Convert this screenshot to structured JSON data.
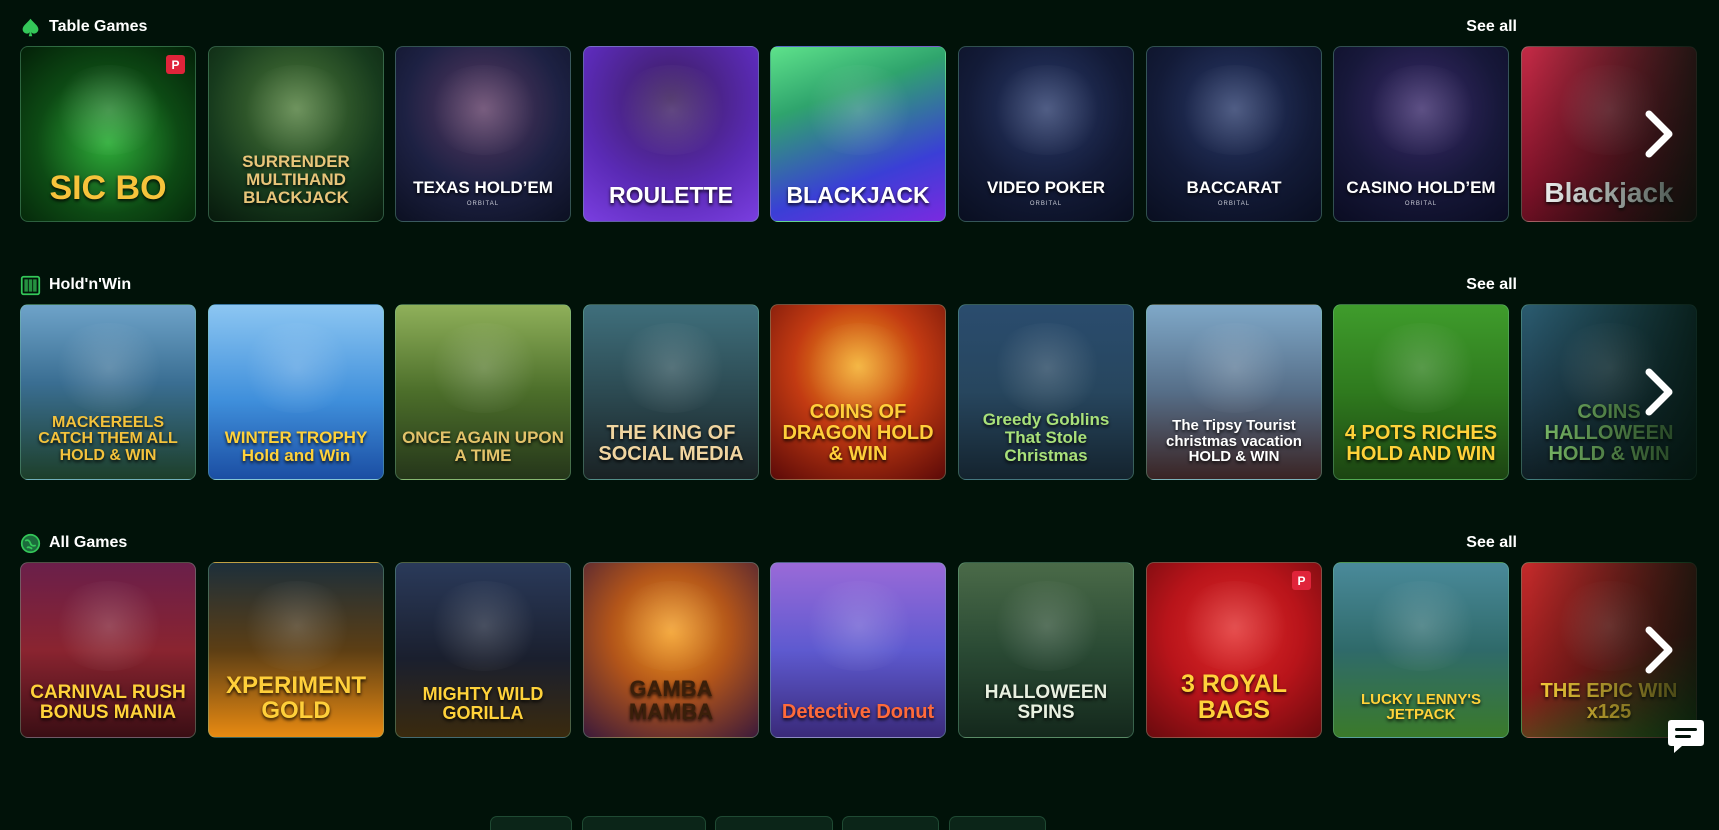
{
  "sections": [
    {
      "title": "Table Games",
      "icon": "spade-icon",
      "see_all": "See all",
      "tiles": [
        {
          "title": "SIC BO",
          "sub": "",
          "badge": "P",
          "bg": "radial-gradient(circle at 50% 55%, #2fae3a 0%, #0d4a14 55%, #032008 100%)",
          "title_color": "#f6c33b",
          "size": 34
        },
        {
          "title": "SURRENDER MULTIHAND BLACKJACK",
          "sub": "",
          "badge": "",
          "bg": "radial-gradient(circle at 50% 35%, #4f7c3b 0%, #173b1d 60%, #07190c 100%)",
          "title_color": "#e8c57a",
          "size": 17
        },
        {
          "title": "TEXAS HOLD’EM",
          "sub": "ORBITAL",
          "badge": "",
          "bg": "radial-gradient(circle at 50% 35%, #5b3a63 0%, #1d2143 55%, #0c1022 100%)",
          "title_color": "#ffffff",
          "size": 17
        },
        {
          "title": "ROULETTE",
          "sub": "",
          "badge": "",
          "bg": "radial-gradient(circle at 50% 30%, #3a1d5a 0%, #5a2ab5 60%, #7a3ee0 100%)",
          "title_color": "#ffffff",
          "size": 23
        },
        {
          "title": "BLACKJACK",
          "sub": "",
          "badge": "",
          "bg": "linear-gradient(160deg, #5ee28b 0%, #2fa46d 30%, #3a3fd6 70%, #7a2ae0 100%)",
          "title_color": "#ffffff",
          "size": 23
        },
        {
          "title": "VIDEO POKER",
          "sub": "ORBITAL",
          "badge": "",
          "bg": "radial-gradient(circle at 50% 35%, #2a3a6a 0%, #131b38 55%, #090e20 100%)",
          "title_color": "#ffffff",
          "size": 17
        },
        {
          "title": "BACCARAT",
          "sub": "ORBITAL",
          "badge": "",
          "bg": "radial-gradient(circle at 50% 35%, #2a3a6a 0%, #131b38 55%, #090e20 100%)",
          "title_color": "#ffffff",
          "size": 17
        },
        {
          "title": "CASINO HOLD’EM",
          "sub": "ORBITAL",
          "badge": "",
          "bg": "radial-gradient(circle at 50% 35%, #3a2a6a 0%, #17183a 55%, #0a0c22 100%)",
          "title_color": "#ffffff",
          "size": 17
        },
        {
          "title": "Blackjack",
          "sub": "",
          "badge": "",
          "bg": "linear-gradient(160deg, #c22a45 0%, #7c1228 60%, #3c0812 100%)",
          "title_color": "#ffffff",
          "size": 28
        }
      ]
    },
    {
      "title": "Hold'n'Win",
      "icon": "slot-machine-icon",
      "see_all": "See all",
      "tiles": [
        {
          "title": "MACKEREELS CATCH THEM ALL HOLD & WIN",
          "sub": "",
          "badge": "",
          "bg": "linear-gradient(180deg, #6ea3c9 0%, #3a6e92 45%, #1d3f2a 100%)",
          "title_color": "#f3c23c",
          "size": 16
        },
        {
          "title": "WINTER TROPHY Hold and Win",
          "sub": "",
          "badge": "",
          "bg": "linear-gradient(180deg, #8cc6f2 0%, #3f8fdb 55%, #1b4ea3 100%)",
          "title_color": "#ffd23a",
          "size": 17
        },
        {
          "title": "ONCE AGAIN UPON A TIME",
          "sub": "",
          "badge": "",
          "bg": "linear-gradient(180deg, #8fb05a 0%, #4c6e2a 50%, #25361a 100%)",
          "title_color": "#e3c36a",
          "size": 17
        },
        {
          "title": "THE KING OF SOCIAL MEDIA",
          "sub": "",
          "badge": "",
          "bg": "linear-gradient(180deg, #3f6f7c 0%, #2c4a52 50%, #1a2224 100%)",
          "title_color": "#f0d5a0",
          "size": 20
        },
        {
          "title": "COINS OF DRAGON HOLD & WIN",
          "sub": "",
          "badge": "",
          "bg": "radial-gradient(circle at 50% 35%, #f2a81e 0%, #c23a12 45%, #5c0a08 100%)",
          "title_color": "#ffcf3a",
          "size": 20
        },
        {
          "title": "Greedy Goblins That Stole Christmas",
          "sub": "",
          "badge": "",
          "bg": "linear-gradient(180deg, #2a4c6e 0%, #27465e 50%, #14232e 100%)",
          "title_color": "#a8e07a",
          "size": 17
        },
        {
          "title": "The Tipsy Tourist christmas vacation HOLD & WIN",
          "sub": "",
          "badge": "",
          "bg": "linear-gradient(180deg, #7fa8c8 0%, #566e88 50%, #3a2424 100%)",
          "title_color": "#ffffff",
          "size": 15
        },
        {
          "title": "4 POTS RICHES HOLD AND WIN",
          "sub": "",
          "badge": "",
          "bg": "linear-gradient(180deg, #3f9c2c 0%, #2f7a1e 50%, #1c4412 100%)",
          "title_color": "#ffd23a",
          "size": 20
        },
        {
          "title": "COINS HALLOWEEN HOLD & WIN",
          "sub": "",
          "badge": "",
          "bg": "linear-gradient(180deg, #2a5a6e 0%, #1f3e4e 50%, #0f1e24 100%)",
          "title_color": "#7fc06a",
          "size": 20
        }
      ]
    },
    {
      "title": "All Games",
      "icon": "globe-icon",
      "see_all": "See all",
      "tiles": [
        {
          "title": "CARNIVAL RUSH BONUS MANIA",
          "sub": "",
          "badge": "",
          "bg": "linear-gradient(180deg, #6a1f4a 0%, #8a2430 50%, #3a0e14 100%)",
          "title_color": "#ffd23a",
          "size": 19
        },
        {
          "title": "XPERIMENT GOLD",
          "sub": "",
          "badge": "",
          "bg": "linear-gradient(180deg, #1d2f3a 0%, #5c3e14 50%, #e88a12 100%)",
          "title_color": "#ffcf3a",
          "size": 24
        },
        {
          "title": "MIGHTY WILD GORILLA",
          "sub": "",
          "badge": "",
          "bg": "linear-gradient(180deg, #2a3a5a 0%, #1a1f2e 55%, #3a2a0e 100%)",
          "title_color": "#ffd23a",
          "size": 18
        },
        {
          "title": "GAMBA MAMBA",
          "sub": "",
          "badge": "",
          "bg": "radial-gradient(circle at 50% 40%, #f29a1e 0%, #b1541a 45%, #3c1a3a 100%)",
          "title_color": "#3a1f0a",
          "size": 22
        },
        {
          "title": "Detective Donut",
          "sub": "",
          "badge": "",
          "bg": "linear-gradient(180deg, #9a6ad8 0%, #5e5ad0 50%, #3a2a7a 100%)",
          "title_color": "#ff6a3a",
          "size": 20
        },
        {
          "title": "HALLOWEEN SPINS",
          "sub": "",
          "badge": "",
          "bg": "linear-gradient(180deg, #4a6a48 0%, #2a4a34 50%, #14281c 100%)",
          "title_color": "#e8f0e0",
          "size": 19
        },
        {
          "title": "3 ROYAL BAGS",
          "sub": "",
          "badge": "P",
          "bg": "radial-gradient(circle at 50% 40%, #e02a2a 0%, #b8141a 50%, #6a0a0e 100%)",
          "title_color": "#ffd23a",
          "size": 25
        },
        {
          "title": "LUCKY LENNY'S JETPACK",
          "sub": "",
          "badge": "",
          "bg": "linear-gradient(180deg, #4a8a9a 0%, #2f6a6a 50%, #3a7a2a 100%)",
          "title_color": "#ffd23a",
          "size": 15
        },
        {
          "title": "THE EPIC WIN x125",
          "sub": "",
          "badge": "",
          "bg": "linear-gradient(160deg, #c22a2a 0%, #8a1a1a 55%, #2a6a1a 100%)",
          "title_color": "#ffd23a",
          "size": 20
        }
      ]
    }
  ],
  "colors": {
    "background": "#011209",
    "accent": "#34c759",
    "badge": "#e0243a"
  }
}
